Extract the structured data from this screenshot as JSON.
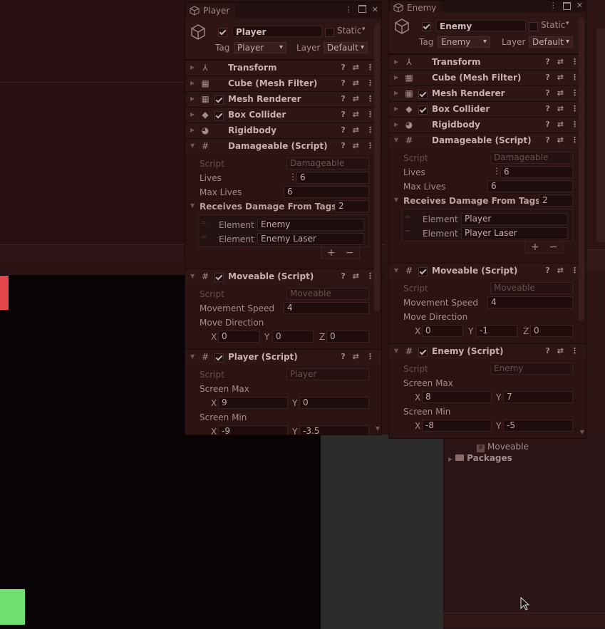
{
  "colors": {
    "enemy_block": "#e4474c",
    "player_block": "#6fe06f",
    "game_view_bg": "#080304",
    "panel_bg": "#2b1314"
  },
  "player_inspector": {
    "tab_title": "Player",
    "object_name": "Player",
    "static_label": "Static",
    "tag_label": "Tag",
    "tag_value": "Player",
    "layer_label": "Layer",
    "layer_value": "Default",
    "components": {
      "transform": "Transform",
      "mesh_filter": "Cube (Mesh Filter)",
      "mesh_renderer": "Mesh Renderer",
      "box_collider": "Box Collider",
      "rigidbody": "Rigidbody",
      "damageable": "Damageable (Script)",
      "moveable": "Moveable (Script)",
      "player_script": "Player (Script)"
    },
    "damageable": {
      "script_label": "Script",
      "script_value": "Damageable",
      "lives_label": "Lives",
      "lives_value": "6",
      "max_lives_label": "Max Lives",
      "max_lives_value": "6",
      "tags_label": "Receives Damage From Tags",
      "tags_count": "2",
      "element0_label": "Element 0",
      "element0_value": "Enemy",
      "element1_label": "Element 1",
      "element1_value": "Enemy Laser"
    },
    "moveable": {
      "script_label": "Script",
      "script_value": "Moveable",
      "speed_label": "Movement Speed",
      "speed_value": "4",
      "direction_label": "Move Direction",
      "x": "0",
      "y": "0",
      "z": "0"
    },
    "player": {
      "script_label": "Script",
      "script_value": "Player",
      "screen_max_label": "Screen Max",
      "max_x": "9",
      "max_y": "0",
      "screen_min_label": "Screen Min",
      "min_x": "-9",
      "min_y": "-3.5"
    }
  },
  "enemy_inspector": {
    "tab_title": "Enemy",
    "object_name": "Enemy",
    "static_label": "Static",
    "tag_label": "Tag",
    "tag_value": "Enemy",
    "layer_label": "Layer",
    "layer_value": "Default",
    "components": {
      "transform": "Transform",
      "mesh_filter": "Cube (Mesh Filter)",
      "mesh_renderer": "Mesh Renderer",
      "box_collider": "Box Collider",
      "rigidbody": "Rigidbody",
      "damageable": "Damageable (Script)",
      "moveable": "Moveable (Script)",
      "enemy_script": "Enemy (Script)"
    },
    "damageable": {
      "script_label": "Script",
      "script_value": "Damageable",
      "lives_label": "Lives",
      "lives_value": "6",
      "max_lives_label": "Max Lives",
      "max_lives_value": "6",
      "tags_label": "Receives Damage From Tags",
      "tags_count": "2",
      "element0_label": "Element 0",
      "element0_value": "Player",
      "element1_label": "Element 1",
      "element1_value": "Player Laser"
    },
    "moveable": {
      "script_label": "Script",
      "script_value": "Moveable",
      "speed_label": "Movement Speed",
      "speed_value": "4",
      "direction_label": "Move Direction",
      "x": "0",
      "y": "-1",
      "z": "0"
    },
    "enemy": {
      "script_label": "Script",
      "script_value": "Enemy",
      "screen_max_label": "Screen Max",
      "max_x": "8",
      "max_y": "7",
      "screen_min_label": "Screen Min",
      "min_x": "-8",
      "min_y": "-5"
    }
  },
  "project": {
    "moveable_label": "Moveable",
    "packages_label": "Packages"
  },
  "axis_labels": {
    "x": "X",
    "y": "Y",
    "z": "Z"
  },
  "glyphs": {
    "help": "?",
    "settings": "⇄",
    "menu": "⋮",
    "plus": "+",
    "minus": "−"
  }
}
